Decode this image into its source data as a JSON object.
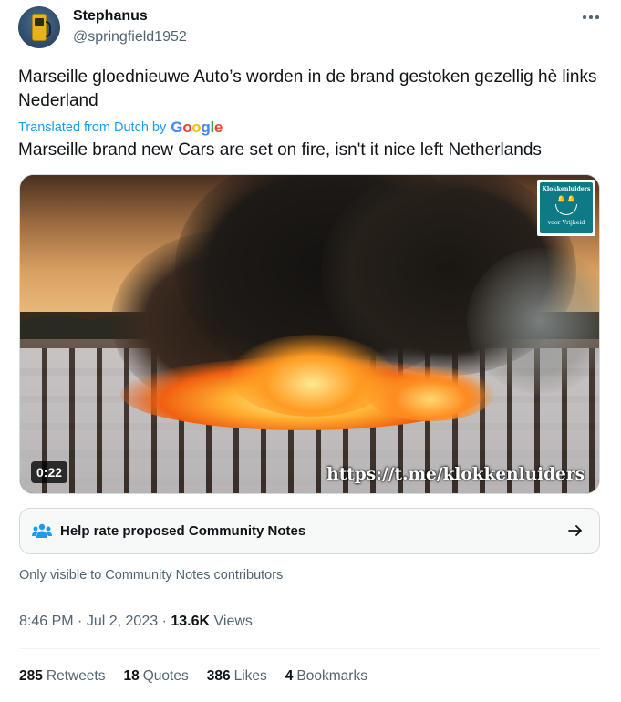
{
  "author": {
    "display_name": "Stephanus",
    "handle": "@springfield1952"
  },
  "tweet": {
    "text": "Marseille gloednieuwe Auto’s worden in de brand gestoken gezellig hè links Nederland",
    "translated_from": "Translated from Dutch by",
    "translator_logo": "Google",
    "translation": "Marseille brand new Cars are set on fire, isn't it nice left Netherlands"
  },
  "media": {
    "duration": "0:22",
    "watermark_url": "https://t.me/klokkenluiders",
    "badge_top": "Klokkenluiders",
    "badge_bells": "🔔 🔔",
    "badge_bottom": "voor Vrijheid"
  },
  "community_notes": {
    "label": "Help rate proposed Community Notes",
    "hint": "Only visible to Community Notes contributors"
  },
  "meta": {
    "time": "8:46 PM",
    "separator": "·",
    "date": "Jul 2, 2023",
    "views_count": "13.6K",
    "views_label": "Views"
  },
  "stats": [
    {
      "count": "285",
      "label": "Retweets"
    },
    {
      "count": "18",
      "label": "Quotes"
    },
    {
      "count": "386",
      "label": "Likes"
    },
    {
      "count": "4",
      "label": "Bookmarks"
    }
  ],
  "icons": {
    "more": "more-dots-icon",
    "community_notes": "community-notes-icon",
    "arrow": "arrow-right-icon"
  },
  "colors": {
    "link_blue": "#1d9bf0",
    "secondary_text": "#536471",
    "primary_text": "#0f1419",
    "border": "#cfd9de"
  }
}
